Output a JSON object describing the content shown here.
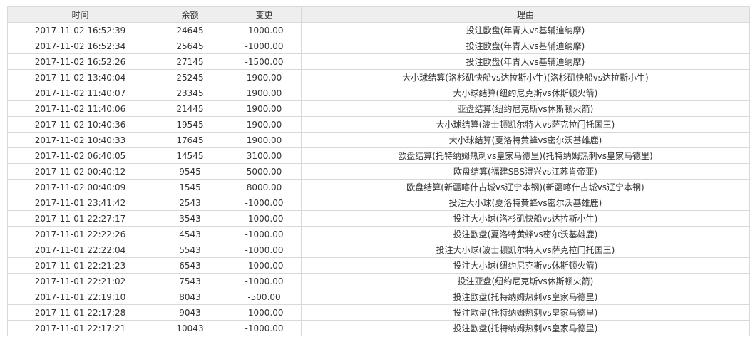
{
  "table": {
    "columns": [
      "时间",
      "余额",
      "变更",
      "理由"
    ],
    "rows": [
      [
        "2017-11-02 16:52:39",
        "24645",
        "-1000.00",
        "投注欧盘(年青人vs基辅迪纳摩)"
      ],
      [
        "2017-11-02 16:52:34",
        "25645",
        "-1000.00",
        "投注欧盘(年青人vs基辅迪纳摩)"
      ],
      [
        "2017-11-02 16:52:26",
        "27145",
        "-1500.00",
        "投注欧盘(年青人vs基辅迪纳摩)"
      ],
      [
        "2017-11-02 13:40:04",
        "25245",
        "1900.00",
        "大小球结算(洛杉矶快船vs达拉斯小牛)(洛杉矶快船vs达拉斯小牛)"
      ],
      [
        "2017-11-02 11:40:07",
        "23345",
        "1900.00",
        "大小球结算(纽约尼克斯vs休斯顿火箭)"
      ],
      [
        "2017-11-02 11:40:06",
        "21445",
        "1900.00",
        "亚盘结算(纽约尼克斯vs休斯顿火箭)"
      ],
      [
        "2017-11-02 10:40:36",
        "19545",
        "1900.00",
        "大小球结算(波士顿凯尔特人vs萨克拉门托国王)"
      ],
      [
        "2017-11-02 10:40:33",
        "17645",
        "1900.00",
        "大小球结算(夏洛特黄蜂vs密尔沃基雄鹿)"
      ],
      [
        "2017-11-02 06:40:05",
        "14545",
        "3100.00",
        "欧盘结算(托特纳姆热刺vs皇家马德里)(托特纳姆热刺vs皇家马德里)"
      ],
      [
        "2017-11-02 00:40:12",
        "9545",
        "5000.00",
        "欧盘结算(福建SBS浔兴vs江苏肯帝亚)"
      ],
      [
        "2017-11-02 00:40:09",
        "1545",
        "8000.00",
        "欧盘结算(新疆喀什古城vs辽宁本钢)(新疆喀什古城vs辽宁本钢)"
      ],
      [
        "2017-11-01 23:41:42",
        "2543",
        "-1000.00",
        "投注大小球(夏洛特黄蜂vs密尔沃基雄鹿)"
      ],
      [
        "2017-11-01 22:27:17",
        "3543",
        "-1000.00",
        "投注大小球(洛杉矶快船vs达拉斯小牛)"
      ],
      [
        "2017-11-01 22:22:26",
        "4543",
        "-1000.00",
        "投注欧盘(夏洛特黄蜂vs密尔沃基雄鹿)"
      ],
      [
        "2017-11-01 22:22:04",
        "5543",
        "-1000.00",
        "投注大小球(波士顿凯尔特人vs萨克拉门托国王)"
      ],
      [
        "2017-11-01 22:21:23",
        "6543",
        "-1000.00",
        "投注大小球(纽约尼克斯vs休斯顿火箭)"
      ],
      [
        "2017-11-01 22:21:02",
        "7543",
        "-1000.00",
        "投注亚盘(纽约尼克斯vs休斯顿火箭)"
      ],
      [
        "2017-11-01 22:19:10",
        "8043",
        "-500.00",
        "投注欧盘(托特纳姆热刺vs皇家马德里)"
      ],
      [
        "2017-11-01 22:17:28",
        "9043",
        "-1000.00",
        "投注欧盘(托特纳姆热刺vs皇家马德里)"
      ],
      [
        "2017-11-01 22:17:21",
        "10043",
        "-1000.00",
        "投注欧盘(托特纳姆热刺vs皇家马德里)"
      ]
    ]
  }
}
